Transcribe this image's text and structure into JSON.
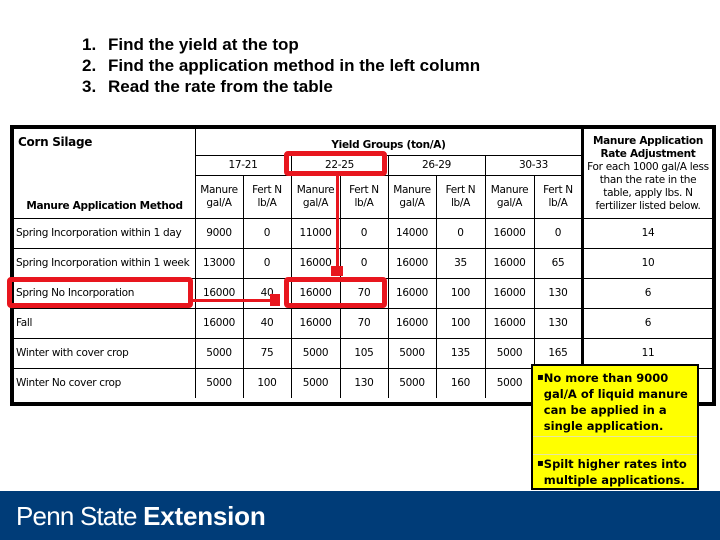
{
  "instructions": [
    {
      "num": "1.",
      "text": "Find the yield at the top"
    },
    {
      "num": "2.",
      "text": "Find the application method in the left column"
    },
    {
      "num": "3.",
      "text": "Read the rate from the table"
    }
  ],
  "table": {
    "crop": "Corn Silage",
    "method_header": "Manure Application Method",
    "yield_groups_header": "Yield Groups (ton/A)",
    "yield_groups": [
      "17-21",
      "22-25",
      "26-29",
      "30-33"
    ],
    "sub_headers": {
      "manure": "Manure gal/A",
      "fert": "Fert N lb/A"
    },
    "adjustment_header": {
      "title": "Manure Application Rate Adjustment",
      "body": "For each 1000 gal/A less than the rate in the table, apply lbs. N fertilizer listed below."
    },
    "rows": [
      {
        "method": "Spring Incorporation within 1 day",
        "values": [
          "9000",
          "0",
          "11000",
          "0",
          "14000",
          "0",
          "16000",
          "0"
        ],
        "adjustment": "14"
      },
      {
        "method": "Spring Incorporation within 1 week",
        "values": [
          "13000",
          "0",
          "16000",
          "0",
          "16000",
          "35",
          "16000",
          "65"
        ],
        "adjustment": "10"
      },
      {
        "method": "Spring No Incorporation",
        "values": [
          "16000",
          "40",
          "16000",
          "70",
          "16000",
          "100",
          "16000",
          "130"
        ],
        "adjustment": "6"
      },
      {
        "method": "Fall",
        "values": [
          "16000",
          "40",
          "16000",
          "70",
          "16000",
          "100",
          "16000",
          "130"
        ],
        "adjustment": "6"
      },
      {
        "method": "Winter with cover crop",
        "values": [
          "5000",
          "75",
          "5000",
          "105",
          "5000",
          "135",
          "5000",
          "165"
        ],
        "adjustment": "11"
      },
      {
        "method": "Winter No cover crop",
        "values": [
          "5000",
          "100",
          "5000",
          "130",
          "5000",
          "160",
          "5000",
          ""
        ],
        "adjustment": ""
      }
    ]
  },
  "highlight": {
    "yield_group": "22-25",
    "method": "Spring No Incorporation",
    "result": {
      "manure": "16000",
      "fert": "70"
    },
    "color": "#e8161e"
  },
  "note": {
    "items": [
      "No more than 9000 gal/A of liquid manure can be applied in a single application.",
      "Spilt higher rates into multiple applications."
    ],
    "bullet": "▪",
    "background": "#ffff00"
  },
  "footer": {
    "brand_regular": "Penn State ",
    "brand_bold": "Extension",
    "background": "#003c78"
  }
}
